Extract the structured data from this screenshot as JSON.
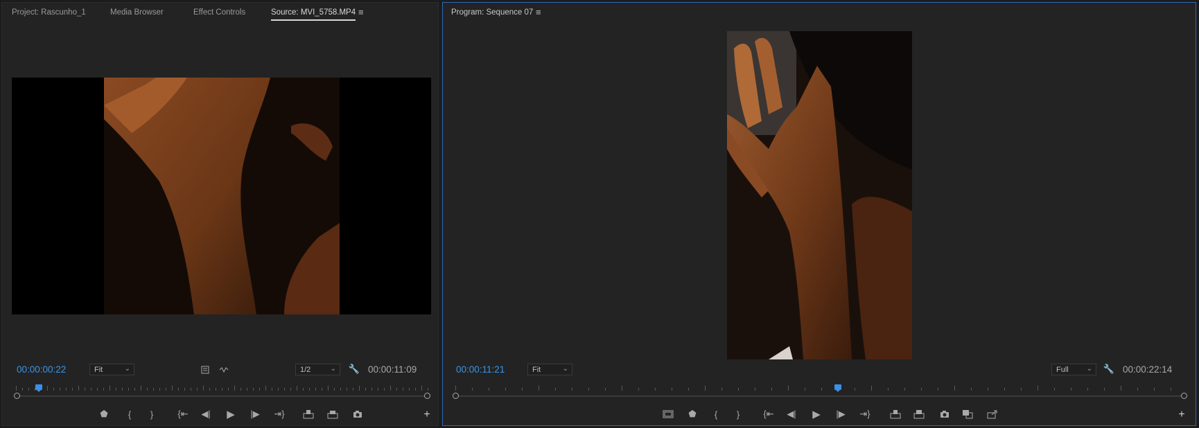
{
  "source": {
    "tabs": [
      {
        "label": "Project: Rascunho_1"
      },
      {
        "label": "Media Browser"
      },
      {
        "label": "Effect Controls"
      },
      {
        "label": "Source: MVI_5758.MP4"
      }
    ],
    "menu_icon": "hamburger-menu-icon",
    "current_timecode": "00:00:00:22",
    "zoom": {
      "selected": "Fit"
    },
    "resolution": {
      "selected": "1/2"
    },
    "duration_timecode": "00:00:11:09",
    "playhead_fraction": 0.06,
    "toolbar_icons": [
      "add-marker-icon",
      "mark-in-icon",
      "mark-out-icon",
      "go-to-in-icon",
      "step-back-icon",
      "play-icon",
      "step-forward-icon",
      "go-to-out-icon",
      "insert-icon",
      "overwrite-icon",
      "export-frame-icon",
      "add-button-icon"
    ],
    "header_icons": [
      "drag-video-only-icon",
      "drag-audio-only-icon",
      "wrench-icon"
    ]
  },
  "program": {
    "title": "Program: Sequence 07",
    "menu_icon": "hamburger-menu-icon",
    "current_timecode": "00:00:11:21",
    "zoom": {
      "selected": "Fit"
    },
    "resolution": {
      "selected": "Full"
    },
    "duration_timecode": "00:00:22:14",
    "playhead_fraction": 0.52,
    "toolbar_icons": [
      "safe-margins-icon",
      "add-marker-icon",
      "mark-in-icon",
      "mark-out-icon",
      "go-to-in-icon",
      "step-back-icon",
      "play-icon",
      "step-forward-icon",
      "go-to-out-icon",
      "lift-icon",
      "extract-icon",
      "export-frame-icon",
      "comparison-view-icon",
      "export-icon",
      "add-button-icon",
      "wrench-icon"
    ]
  },
  "colors": {
    "accent": "#3a94e8",
    "panel_bg": "#232323",
    "focus_border": "#2d6bbf"
  }
}
